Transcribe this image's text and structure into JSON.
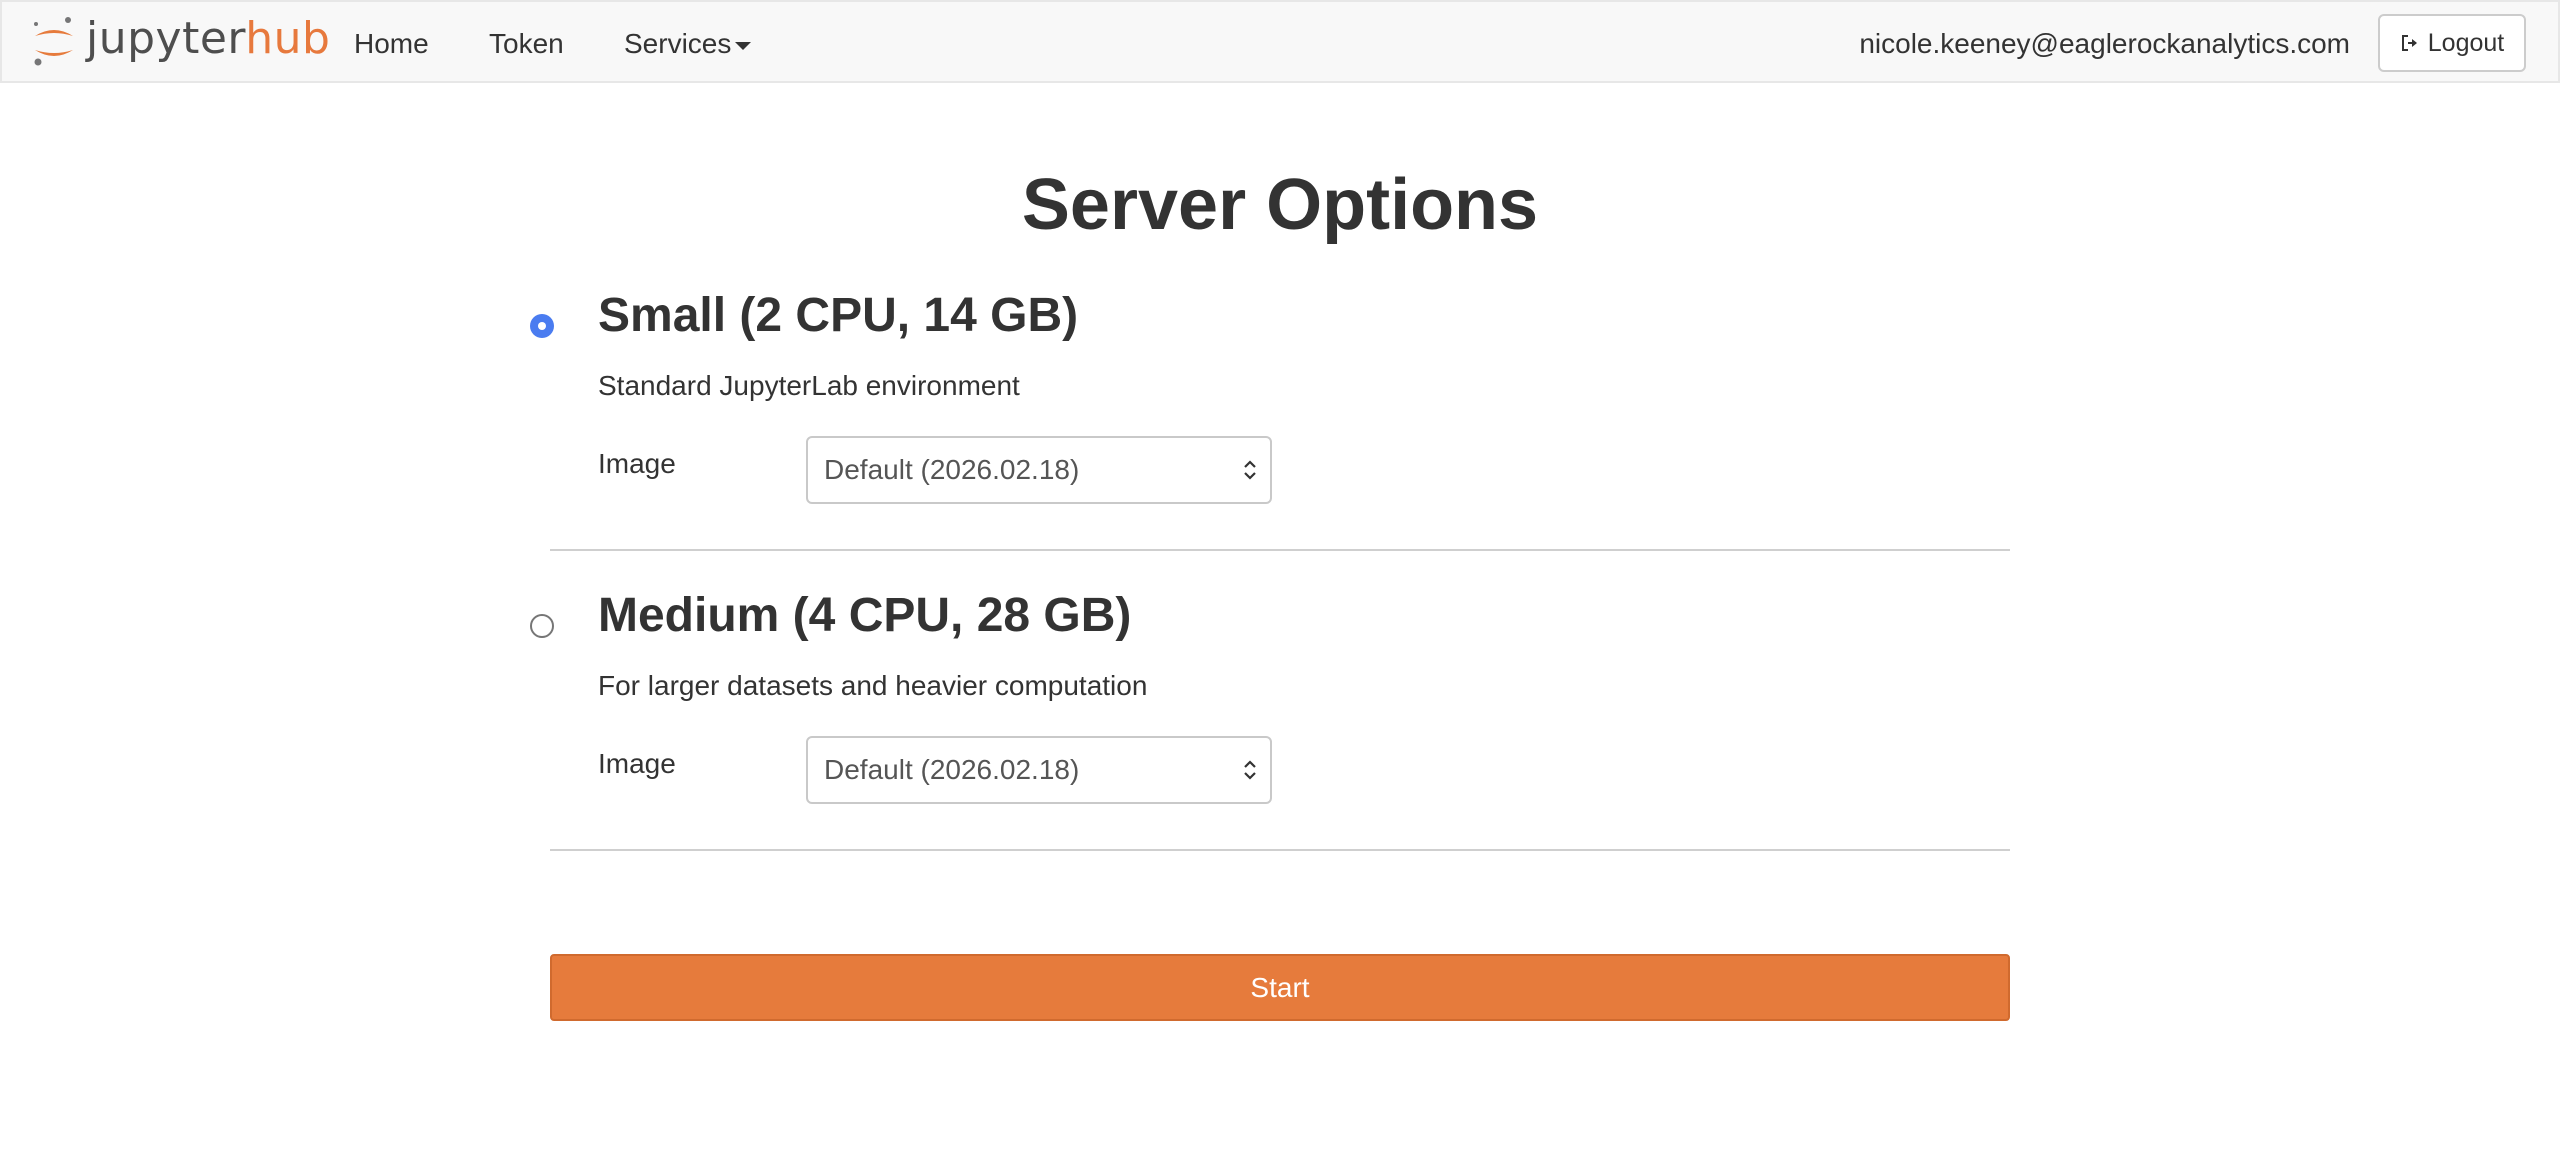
{
  "navbar": {
    "brand_part1": "jupyter",
    "brand_part2": "hub",
    "links": [
      {
        "label": "Home"
      },
      {
        "label": "Token"
      },
      {
        "label": "Services"
      }
    ],
    "user_email": "nicole.keeney@eaglerockanalytics.com",
    "logout_label": "Logout"
  },
  "page": {
    "title": "Server Options"
  },
  "options": [
    {
      "name": "Small (2 CPU, 14 GB)",
      "description": "Standard JupyterLab environment",
      "image_label": "Image",
      "image_value": "Default (2026.02.18)",
      "selected": true
    },
    {
      "name": "Medium (4 CPU, 28 GB)",
      "description": "For larger datasets and heavier computation",
      "image_label": "Image",
      "image_value": "Default (2026.02.18)",
      "selected": false
    }
  ],
  "start_label": "Start",
  "colors": {
    "accent": "#e67b3c",
    "radio_selected": "#4a7cf0",
    "navbar_bg": "#f8f8f8"
  },
  "icons": {
    "logo": "jupyter-logo-icon",
    "services_caret": "caret-down-icon",
    "logout": "sign-out-icon",
    "select": "select-arrows-icon"
  }
}
